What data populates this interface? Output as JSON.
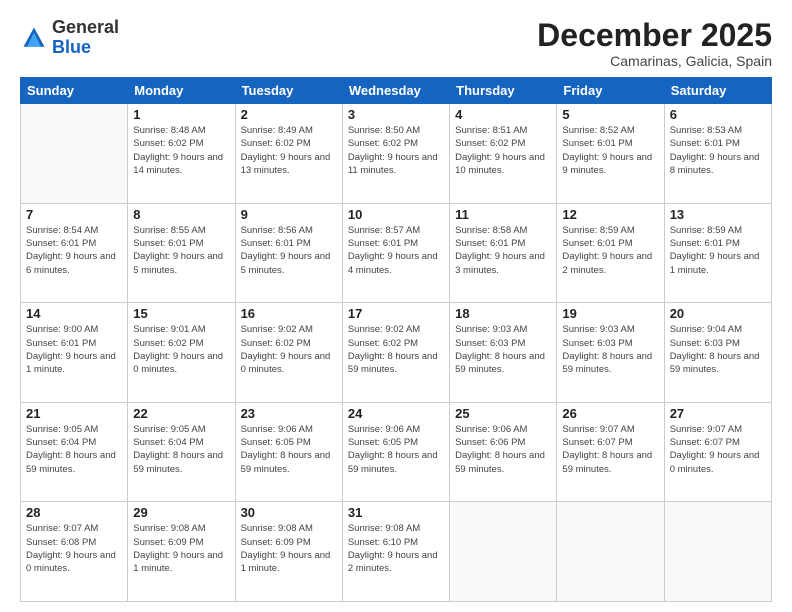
{
  "logo": {
    "general": "General",
    "blue": "Blue"
  },
  "header": {
    "month": "December 2025",
    "location": "Camarinas, Galicia, Spain"
  },
  "weekdays": [
    "Sunday",
    "Monday",
    "Tuesday",
    "Wednesday",
    "Thursday",
    "Friday",
    "Saturday"
  ],
  "weeks": [
    [
      {
        "day": null
      },
      {
        "day": 1,
        "sunrise": "8:48 AM",
        "sunset": "6:02 PM",
        "daylight": "9 hours and 14 minutes."
      },
      {
        "day": 2,
        "sunrise": "8:49 AM",
        "sunset": "6:02 PM",
        "daylight": "9 hours and 13 minutes."
      },
      {
        "day": 3,
        "sunrise": "8:50 AM",
        "sunset": "6:02 PM",
        "daylight": "9 hours and 11 minutes."
      },
      {
        "day": 4,
        "sunrise": "8:51 AM",
        "sunset": "6:02 PM",
        "daylight": "9 hours and 10 minutes."
      },
      {
        "day": 5,
        "sunrise": "8:52 AM",
        "sunset": "6:01 PM",
        "daylight": "9 hours and 9 minutes."
      },
      {
        "day": 6,
        "sunrise": "8:53 AM",
        "sunset": "6:01 PM",
        "daylight": "9 hours and 8 minutes."
      }
    ],
    [
      {
        "day": 7,
        "sunrise": "8:54 AM",
        "sunset": "6:01 PM",
        "daylight": "9 hours and 6 minutes."
      },
      {
        "day": 8,
        "sunrise": "8:55 AM",
        "sunset": "6:01 PM",
        "daylight": "9 hours and 5 minutes."
      },
      {
        "day": 9,
        "sunrise": "8:56 AM",
        "sunset": "6:01 PM",
        "daylight": "9 hours and 5 minutes."
      },
      {
        "day": 10,
        "sunrise": "8:57 AM",
        "sunset": "6:01 PM",
        "daylight": "9 hours and 4 minutes."
      },
      {
        "day": 11,
        "sunrise": "8:58 AM",
        "sunset": "6:01 PM",
        "daylight": "9 hours and 3 minutes."
      },
      {
        "day": 12,
        "sunrise": "8:59 AM",
        "sunset": "6:01 PM",
        "daylight": "9 hours and 2 minutes."
      },
      {
        "day": 13,
        "sunrise": "8:59 AM",
        "sunset": "6:01 PM",
        "daylight": "9 hours and 1 minute."
      }
    ],
    [
      {
        "day": 14,
        "sunrise": "9:00 AM",
        "sunset": "6:01 PM",
        "daylight": "9 hours and 1 minute."
      },
      {
        "day": 15,
        "sunrise": "9:01 AM",
        "sunset": "6:02 PM",
        "daylight": "9 hours and 0 minutes."
      },
      {
        "day": 16,
        "sunrise": "9:02 AM",
        "sunset": "6:02 PM",
        "daylight": "9 hours and 0 minutes."
      },
      {
        "day": 17,
        "sunrise": "9:02 AM",
        "sunset": "6:02 PM",
        "daylight": "8 hours and 59 minutes."
      },
      {
        "day": 18,
        "sunrise": "9:03 AM",
        "sunset": "6:03 PM",
        "daylight": "8 hours and 59 minutes."
      },
      {
        "day": 19,
        "sunrise": "9:03 AM",
        "sunset": "6:03 PM",
        "daylight": "8 hours and 59 minutes."
      },
      {
        "day": 20,
        "sunrise": "9:04 AM",
        "sunset": "6:03 PM",
        "daylight": "8 hours and 59 minutes."
      }
    ],
    [
      {
        "day": 21,
        "sunrise": "9:05 AM",
        "sunset": "6:04 PM",
        "daylight": "8 hours and 59 minutes."
      },
      {
        "day": 22,
        "sunrise": "9:05 AM",
        "sunset": "6:04 PM",
        "daylight": "8 hours and 59 minutes."
      },
      {
        "day": 23,
        "sunrise": "9:06 AM",
        "sunset": "6:05 PM",
        "daylight": "8 hours and 59 minutes."
      },
      {
        "day": 24,
        "sunrise": "9:06 AM",
        "sunset": "6:05 PM",
        "daylight": "8 hours and 59 minutes."
      },
      {
        "day": 25,
        "sunrise": "9:06 AM",
        "sunset": "6:06 PM",
        "daylight": "8 hours and 59 minutes."
      },
      {
        "day": 26,
        "sunrise": "9:07 AM",
        "sunset": "6:07 PM",
        "daylight": "8 hours and 59 minutes."
      },
      {
        "day": 27,
        "sunrise": "9:07 AM",
        "sunset": "6:07 PM",
        "daylight": "9 hours and 0 minutes."
      }
    ],
    [
      {
        "day": 28,
        "sunrise": "9:07 AM",
        "sunset": "6:08 PM",
        "daylight": "9 hours and 0 minutes."
      },
      {
        "day": 29,
        "sunrise": "9:08 AM",
        "sunset": "6:09 PM",
        "daylight": "9 hours and 1 minute."
      },
      {
        "day": 30,
        "sunrise": "9:08 AM",
        "sunset": "6:09 PM",
        "daylight": "9 hours and 1 minute."
      },
      {
        "day": 31,
        "sunrise": "9:08 AM",
        "sunset": "6:10 PM",
        "daylight": "9 hours and 2 minutes."
      },
      {
        "day": null
      },
      {
        "day": null
      },
      {
        "day": null
      }
    ]
  ]
}
